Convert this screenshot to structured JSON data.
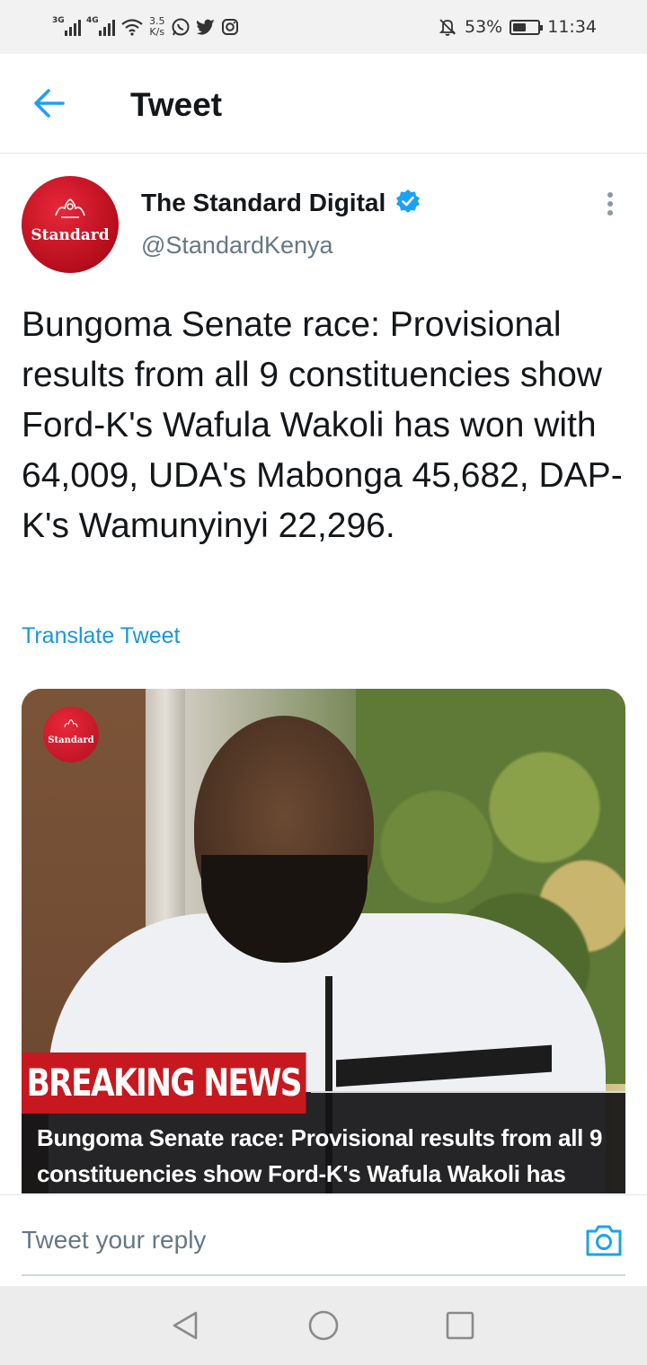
{
  "status_bar": {
    "network1": "3G",
    "network2": "4G",
    "speed_value": "3.5",
    "speed_unit": "K/s",
    "battery_percent": "53%",
    "battery_level": 0.53,
    "time": "11:34",
    "icons": [
      "signal-3g-icon",
      "signal-4g-icon",
      "wifi-icon",
      "whatsapp-icon",
      "twitter-icon",
      "instagram-icon",
      "mute-icon",
      "battery-icon"
    ]
  },
  "header": {
    "title": "Tweet"
  },
  "tweet": {
    "author_name": "The Standard Digital",
    "author_handle": "@StandardKenya",
    "avatar_text": "Standard",
    "text": "Bungoma Senate race: Provisional results from all 9 constituencies show Ford-K's Wafula Wakoli has won with 64,009, UDA's Mabonga 45,682, DAP-K's Wamunyinyi 22,296.",
    "translate_label": "Translate Tweet"
  },
  "media": {
    "logo_text": "Standard",
    "banner": "BREAKING NEWS",
    "caption": "Bungoma Senate race: Provisional results from all 9 constituencies show Ford-K's Wafula Wakoli has"
  },
  "reply": {
    "placeholder": "Tweet your reply"
  },
  "colors": {
    "accent": "#1da1f2",
    "link": "#1b95e0",
    "brand_red": "#c7181f",
    "text_secondary": "#657786"
  }
}
